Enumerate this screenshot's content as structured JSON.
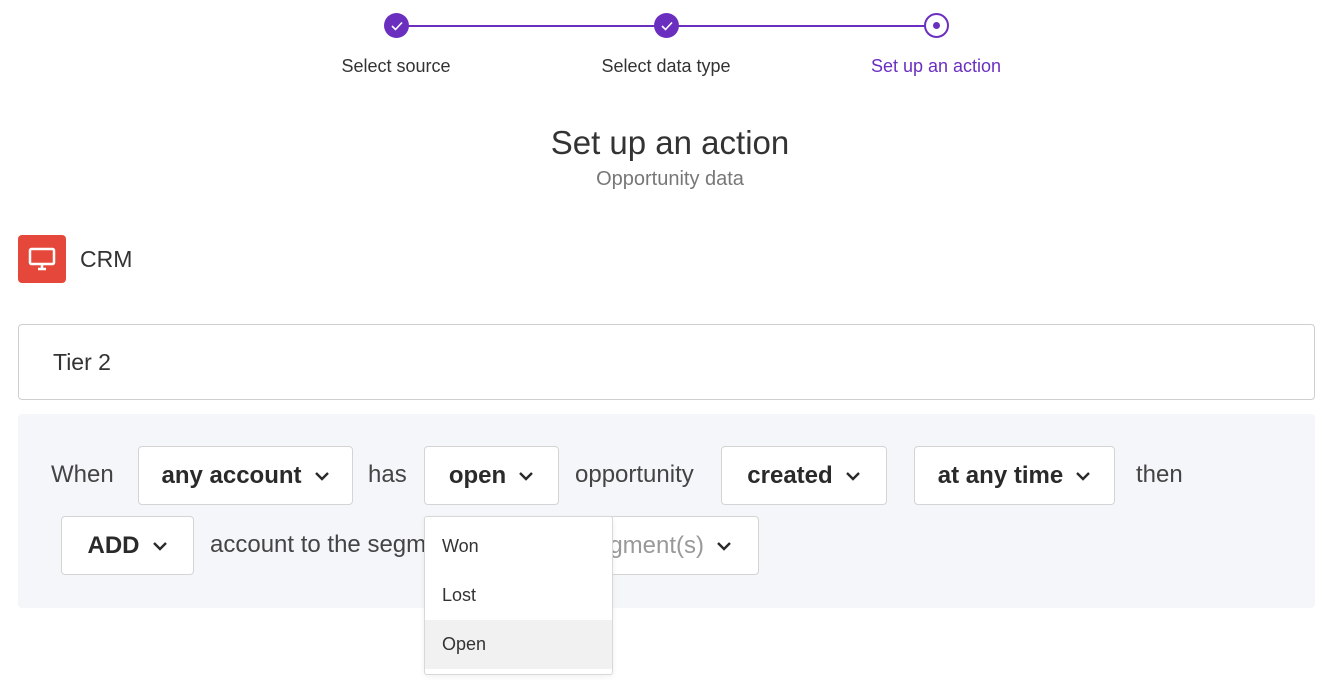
{
  "stepper": {
    "steps": [
      {
        "label": "Select source",
        "state": "done"
      },
      {
        "label": "Select data type",
        "state": "done"
      },
      {
        "label": "Set up an action",
        "state": "current"
      }
    ],
    "accent": "#6b2fc0"
  },
  "header": {
    "title": "Set up an action",
    "subtitle": "Opportunity data"
  },
  "source": {
    "icon": "monitor-icon",
    "icon_bg": "#e5483a",
    "label": "CRM"
  },
  "name_field": {
    "value": "Tier 2"
  },
  "rule": {
    "when": "When",
    "subject_dropdown": "any account",
    "has": "has",
    "status_dropdown": "open",
    "opportunity": "opportunity",
    "event_dropdown": "created",
    "time_dropdown": "at any time",
    "then": "then",
    "action_dropdown": "ADD",
    "target_text": "account to the segm",
    "segment_placeholder": "gment(s)"
  },
  "status_menu": {
    "options": [
      "Won",
      "Lost",
      "Open"
    ],
    "selected": "Open"
  }
}
